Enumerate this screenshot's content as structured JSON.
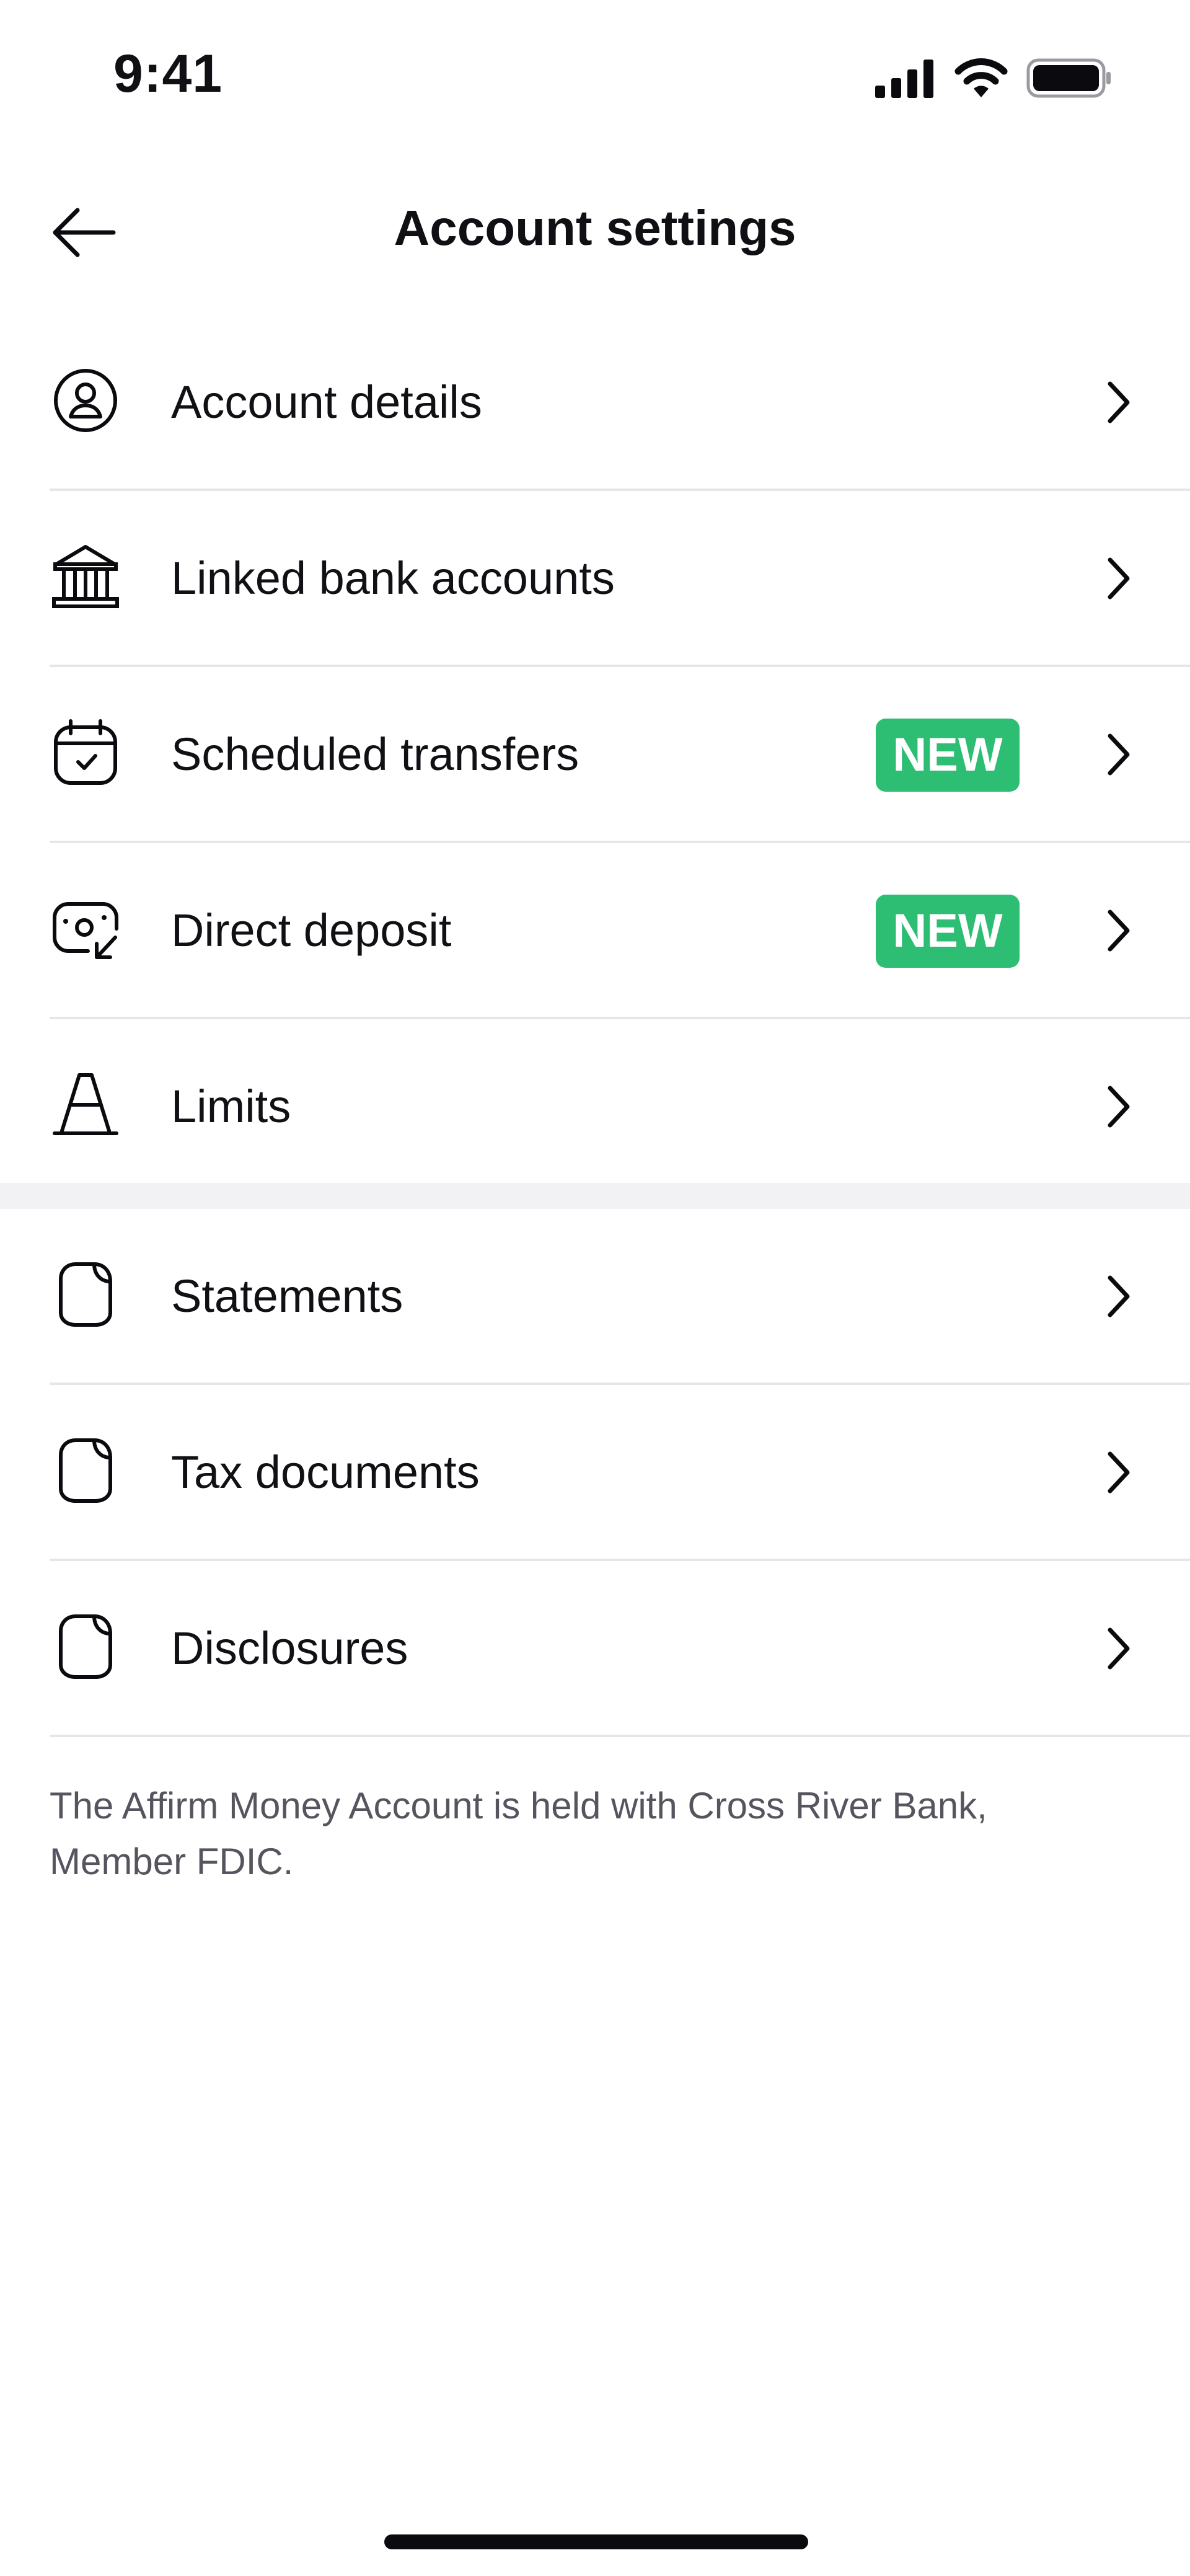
{
  "status_bar": {
    "time": "9:41",
    "icons": [
      "cellular-signal-icon",
      "wifi-icon",
      "battery-icon"
    ]
  },
  "header": {
    "back_icon": "arrow-left-icon",
    "title": "Account settings"
  },
  "accent": "#2ebe73",
  "section_account": [
    {
      "icon": "user-circle-icon",
      "label": "Account details",
      "badge": ""
    },
    {
      "icon": "bank-icon",
      "label": "Linked bank accounts",
      "badge": ""
    },
    {
      "icon": "calendar-check-icon",
      "label": "Scheduled transfers",
      "badge": "NEW"
    },
    {
      "icon": "deposit-icon",
      "label": "Direct deposit",
      "badge": "NEW"
    },
    {
      "icon": "cone-icon",
      "label": "Limits",
      "badge": ""
    }
  ],
  "section_documents": [
    {
      "icon": "document-icon",
      "label": "Statements"
    },
    {
      "icon": "document-icon",
      "label": "Tax documents"
    },
    {
      "icon": "document-icon",
      "label": "Disclosures"
    }
  ],
  "footer": {
    "note": "The Affirm Money Account is held with Cross River Bank, Member FDIC."
  }
}
